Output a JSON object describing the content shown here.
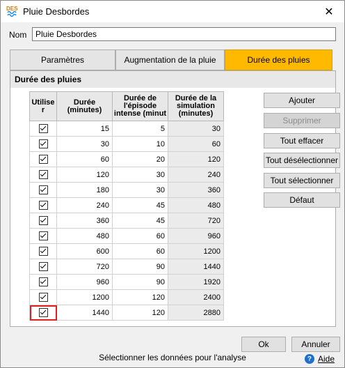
{
  "window": {
    "title": "Pluie Desbordes",
    "icon_text": "DES",
    "close_glyph": "✕"
  },
  "name_field": {
    "label": "Nom",
    "value": "Pluie Desbordes"
  },
  "tabs": [
    {
      "label": "Paramètres",
      "active": false
    },
    {
      "label": "Augmentation de la pluie",
      "active": false
    },
    {
      "label": "Durée des pluies",
      "active": true
    }
  ],
  "panel": {
    "header": "Durée des pluies"
  },
  "table": {
    "columns": [
      "Utilise r",
      "Durée (minutes)",
      "Durée de l'épisode intense (minut",
      "Durée de la simulation (minutes)"
    ],
    "rows": [
      {
        "checked": true,
        "duree": "15",
        "intense": "5",
        "simulation": "30"
      },
      {
        "checked": true,
        "duree": "30",
        "intense": "10",
        "simulation": "60"
      },
      {
        "checked": true,
        "duree": "60",
        "intense": "20",
        "simulation": "120"
      },
      {
        "checked": true,
        "duree": "120",
        "intense": "30",
        "simulation": "240"
      },
      {
        "checked": true,
        "duree": "180",
        "intense": "30",
        "simulation": "360"
      },
      {
        "checked": true,
        "duree": "240",
        "intense": "45",
        "simulation": "480"
      },
      {
        "checked": true,
        "duree": "360",
        "intense": "45",
        "simulation": "720"
      },
      {
        "checked": true,
        "duree": "480",
        "intense": "60",
        "simulation": "960"
      },
      {
        "checked": true,
        "duree": "600",
        "intense": "60",
        "simulation": "1200"
      },
      {
        "checked": true,
        "duree": "720",
        "intense": "90",
        "simulation": "1440"
      },
      {
        "checked": true,
        "duree": "960",
        "intense": "90",
        "simulation": "1920"
      },
      {
        "checked": true,
        "duree": "1200",
        "intense": "120",
        "simulation": "2400"
      },
      {
        "checked": true,
        "duree": "1440",
        "intense": "120",
        "simulation": "2880"
      }
    ]
  },
  "side_buttons": [
    {
      "label": "Ajouter",
      "disabled": false
    },
    {
      "label": "Supprimer",
      "disabled": true
    },
    {
      "label": "Tout effacer",
      "disabled": false
    },
    {
      "label": "Tout désélectionner",
      "disabled": false
    },
    {
      "label": "Tout sélectionner",
      "disabled": false
    },
    {
      "label": "Défaut",
      "disabled": false
    }
  ],
  "footer": {
    "ok_label": "Ok",
    "cancel_label": "Annuler",
    "status_text": "Sélectionner les données pour l'analyse",
    "help_label": "Aide",
    "help_icon_glyph": "?"
  },
  "colors": {
    "active_tab": "#ffb900",
    "focus_outline": "#e02020",
    "help_icon": "#1e6fd1"
  }
}
